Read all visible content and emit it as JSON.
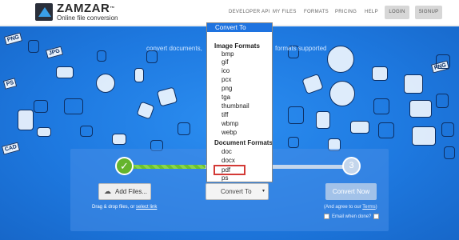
{
  "header": {
    "logo_name": "ZAMZAR",
    "logo_tm": "™",
    "logo_tagline": "Online file conversion",
    "nav": [
      "DEVELOPER API",
      "MY FILES",
      "FORMATS",
      "PRICING",
      "HELP"
    ],
    "login_label": "LOGIN",
    "signup_label": "SIGNUP"
  },
  "hero": {
    "tagline_left": "convert documents,",
    "tagline_right": "formats supported"
  },
  "converter": {
    "step1_icon": "✓",
    "step3_number": "3",
    "add_files_icon": "upload-icon",
    "add_files_label": "Add Files...",
    "drag_text": "Drag & drop files, or",
    "drag_link": "select link",
    "convert_to_label": "Convert To",
    "select_arrow": "▾",
    "convert_now_label": "Convert Now",
    "agree_text": "(And agree to our",
    "agree_link": "Terms",
    "agree_close": ")",
    "email_label": "Email when done?"
  },
  "dropdown": {
    "selected": "Convert To",
    "groups": [
      {
        "label": "Image Formats",
        "items": [
          "bmp",
          "gif",
          "ico",
          "pcx",
          "png",
          "tga",
          "thumbnail",
          "tiff",
          "wbmp",
          "webp"
        ]
      },
      {
        "label": "Document Formats",
        "items": [
          "doc",
          "docx",
          "pdf",
          "ps"
        ]
      }
    ],
    "highlighted_item": "pdf"
  },
  "colors": {
    "hero_blue": "#1e79e0",
    "dropdown_selected": "#1e73e0",
    "step_green": "#65b42c",
    "highlight_red": "#d33a36"
  },
  "bg_labels": [
    "PNG",
    "JPG",
    "PS",
    "CAD",
    "PNG"
  ]
}
